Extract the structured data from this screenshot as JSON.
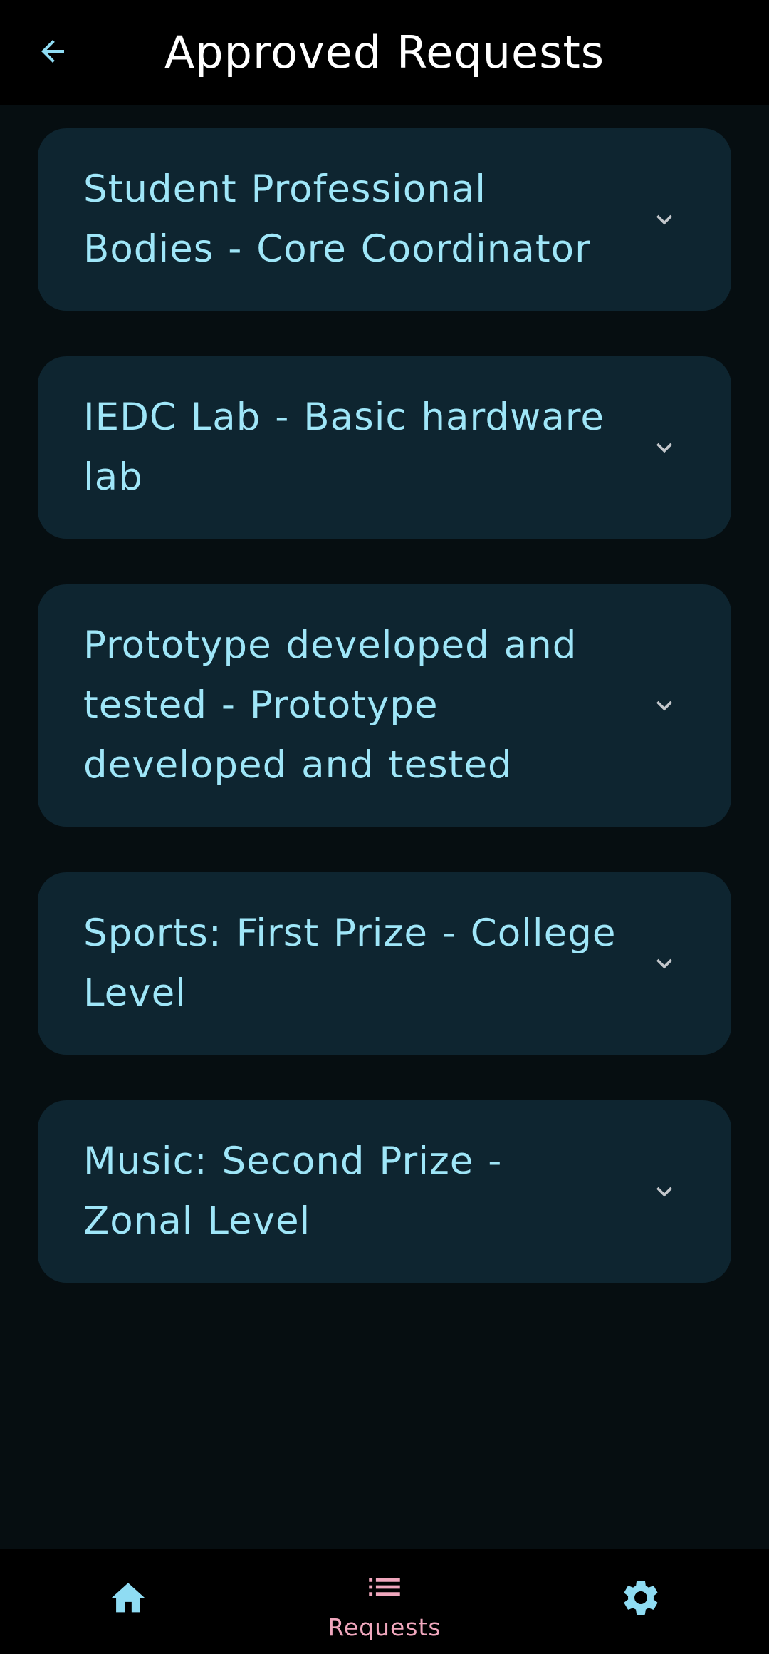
{
  "header": {
    "title": "Approved Requests",
    "back_icon": "arrow-left-icon"
  },
  "requests": [
    {
      "title": "Student Professional Bodies - Core Coordinator"
    },
    {
      "title": "IEDC Lab - Basic hardware lab"
    },
    {
      "title": "Prototype developed and tested - Prototype developed and tested"
    },
    {
      "title": "Sports: First Prize - College Level"
    },
    {
      "title": "Music: Second Prize - Zonal Level"
    }
  ],
  "bottom_nav": {
    "items": [
      {
        "icon": "home-icon",
        "label": ""
      },
      {
        "icon": "list-icon",
        "label": "Requests",
        "active": true
      },
      {
        "icon": "gear-icon",
        "label": ""
      }
    ]
  },
  "colors": {
    "background": "#060e11",
    "header": "#000000",
    "card": "#0e2530",
    "card_text": "#9fe6f8",
    "accent_blue": "#8fdcf3",
    "active_pink": "#f0a7bd"
  }
}
